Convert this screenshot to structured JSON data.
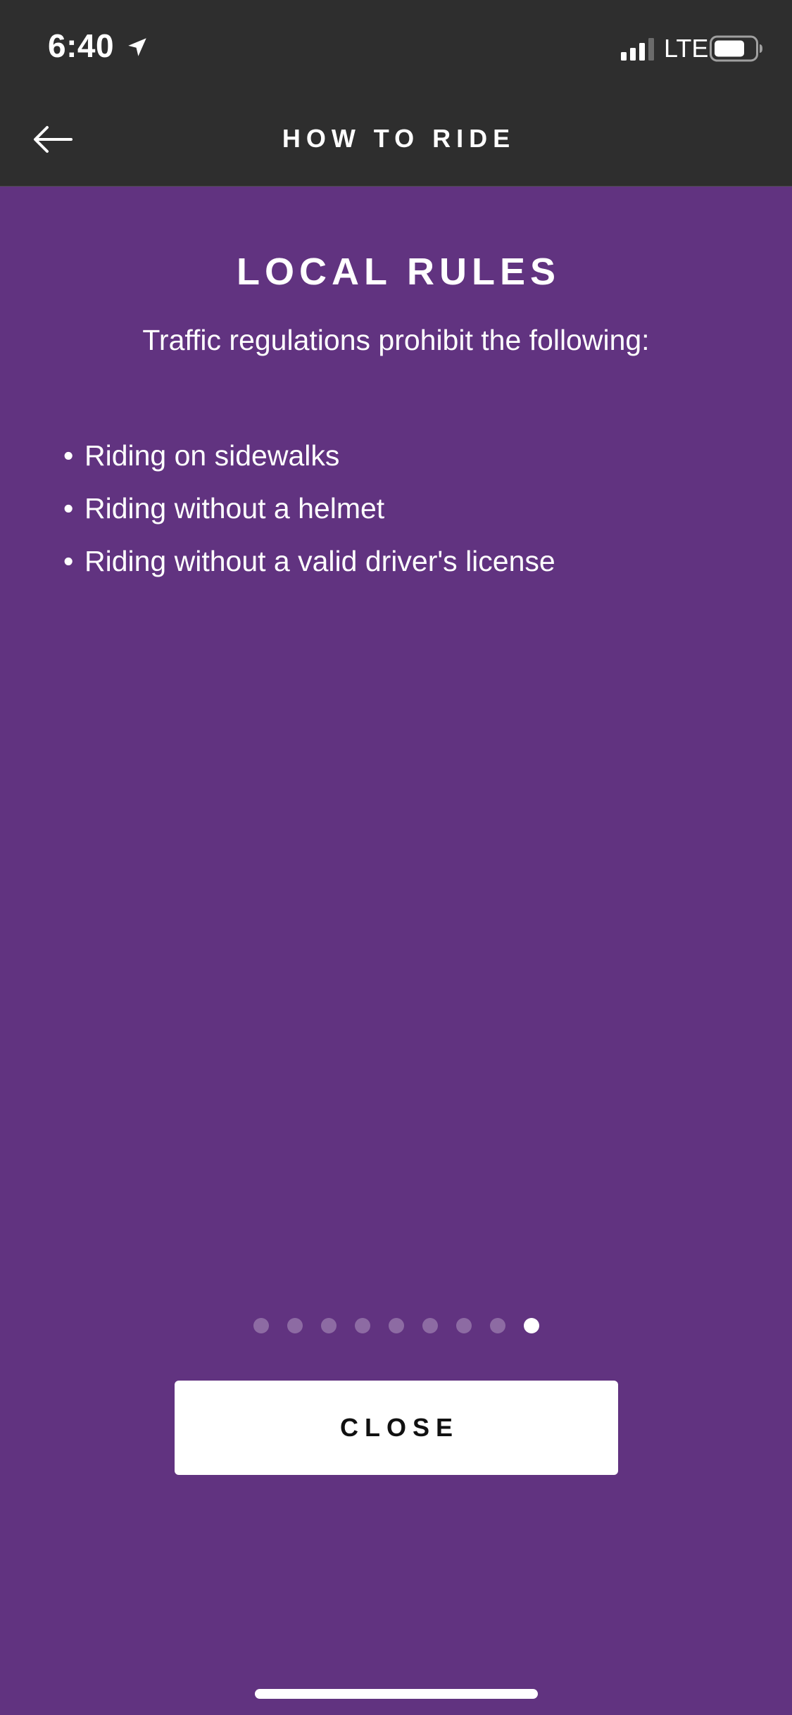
{
  "status_bar": {
    "time": "6:40",
    "network": "LTE",
    "icons": [
      "location-arrow-icon",
      "cellular-signal-icon",
      "battery-icon"
    ]
  },
  "nav": {
    "title": "HOW TO RIDE",
    "back_icon": "arrow-left-icon"
  },
  "page": {
    "title": "LOCAL RULES",
    "subtitle": "Traffic regulations prohibit the following:",
    "rules": [
      "Riding on sidewalks",
      "Riding without a helmet",
      "Riding without a valid driver's license"
    ],
    "bullet": "•"
  },
  "pager": {
    "total": 9,
    "current": 9
  },
  "actions": {
    "close_label": "CLOSE"
  },
  "colors": {
    "background": "#613380",
    "header": "#2e2e2e",
    "button": "#ffffff",
    "text": "#ffffff"
  }
}
